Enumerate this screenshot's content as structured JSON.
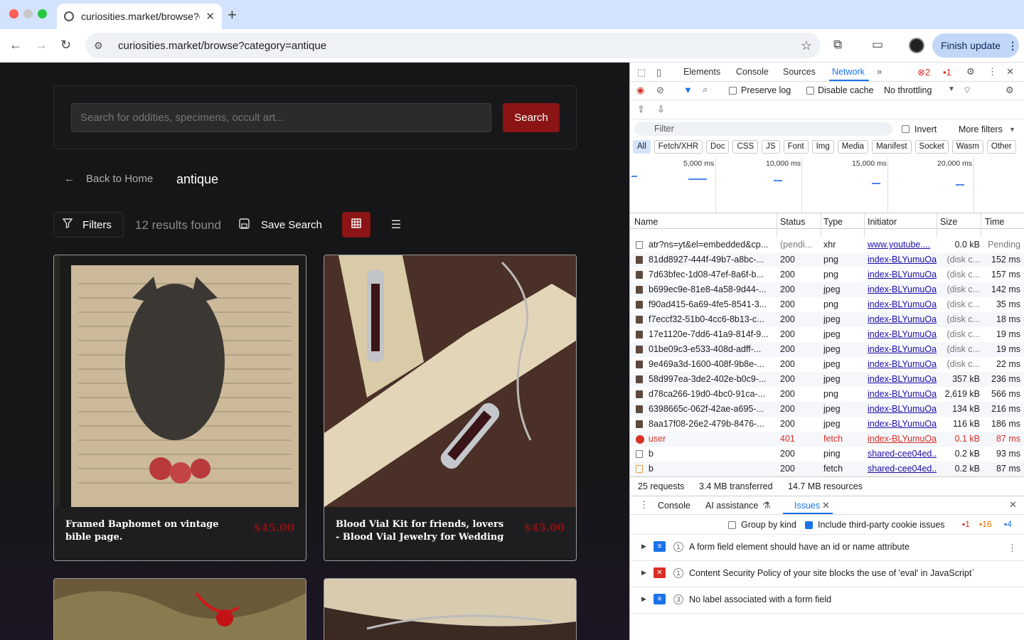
{
  "browser": {
    "tab_title": "curiosities.market/browse?ca",
    "url": "curiosities.market/browse?category=antique",
    "update_label": "Finish update"
  },
  "page": {
    "search_placeholder": "Search for oddities, specimens, occult art...",
    "search_button": "Search",
    "back_label": "Back to Home",
    "category_title": "antique",
    "filters_label": "Filters",
    "results_text": "12 results found",
    "save_search_label": "Save Search",
    "products": [
      {
        "name": "Framed Baphomet on vintage bible page.",
        "price": "$45.00"
      },
      {
        "name": "Blood Vial Kit for friends, lovers - Blood Vial Jewelry for Wedding",
        "price": "$45.00"
      }
    ]
  },
  "devtools": {
    "tabs": [
      "Elements",
      "Console",
      "Sources",
      "Network"
    ],
    "selected_tab": "Network",
    "error_count": "2",
    "warning_count": "1",
    "preserve_log": "Preserve log",
    "disable_cache": "Disable cache",
    "throttling": "No throttling",
    "filter_placeholder": "Filter",
    "invert": "Invert",
    "more_filters": "More filters",
    "type_filters": [
      "All",
      "Fetch/XHR",
      "Doc",
      "CSS",
      "JS",
      "Font",
      "Img",
      "Media",
      "Manifest",
      "Socket",
      "Wasm",
      "Other"
    ],
    "timeline_ticks": [
      "5,000 ms",
      "10,000 ms",
      "15,000 ms",
      "20,000 ms"
    ],
    "columns": [
      "Name",
      "Status",
      "Type",
      "Initiator",
      "Size",
      "Time"
    ],
    "rows": [
      {
        "name": "atr?ns=yt&el=embedded&cp...",
        "status": "(pendi...",
        "type": "xhr",
        "initiator": "www.youtube....",
        "size": "0.0 kB",
        "time": "Pending",
        "kind": "doc"
      },
      {
        "name": "81dd8927-444f-49b7-a8bc-...",
        "status": "200",
        "type": "png",
        "initiator": "index-BLYumuOa",
        "size": "(disk c...",
        "time": "152 ms",
        "kind": "img"
      },
      {
        "name": "7d63bfec-1d08-47ef-8a6f-b...",
        "status": "200",
        "type": "png",
        "initiator": "index-BLYumuOa",
        "size": "(disk c...",
        "time": "157 ms",
        "kind": "img"
      },
      {
        "name": "b699ec9e-81e8-4a58-9d44-...",
        "status": "200",
        "type": "jpeg",
        "initiator": "index-BLYumuOa",
        "size": "(disk c...",
        "time": "142 ms",
        "kind": "img"
      },
      {
        "name": "f90ad415-6a69-4fe5-8541-3...",
        "status": "200",
        "type": "png",
        "initiator": "index-BLYumuOa",
        "size": "(disk c...",
        "time": "35 ms",
        "kind": "img"
      },
      {
        "name": "f7eccf32-51b0-4cc6-8b13-c...",
        "status": "200",
        "type": "jpeg",
        "initiator": "index-BLYumuOa",
        "size": "(disk c...",
        "time": "18 ms",
        "kind": "img"
      },
      {
        "name": "17e1120e-7dd6-41a9-814f-9...",
        "status": "200",
        "type": "jpeg",
        "initiator": "index-BLYumuOa",
        "size": "(disk c...",
        "time": "19 ms",
        "kind": "img"
      },
      {
        "name": "01be09c3-e533-408d-adff-...",
        "status": "200",
        "type": "jpeg",
        "initiator": "index-BLYumuOa",
        "size": "(disk c...",
        "time": "19 ms",
        "kind": "img"
      },
      {
        "name": "9e469a3d-1600-408f-9b8e-...",
        "status": "200",
        "type": "jpeg",
        "initiator": "index-BLYumuOa",
        "size": "(disk c...",
        "time": "22 ms",
        "kind": "img"
      },
      {
        "name": "58d997ea-3de2-402e-b0c9-...",
        "status": "200",
        "type": "jpeg",
        "initiator": "index-BLYumuOa",
        "size": "357 kB",
        "time": "236 ms",
        "kind": "img"
      },
      {
        "name": "d78ca266-19d0-4bc0-91ca-...",
        "status": "200",
        "type": "png",
        "initiator": "index-BLYumuOa",
        "size": "2,619 kB",
        "time": "566 ms",
        "kind": "img"
      },
      {
        "name": "6398665c-062f-42ae-a695-...",
        "status": "200",
        "type": "jpeg",
        "initiator": "index-BLYumuOa",
        "size": "134 kB",
        "time": "216 ms",
        "kind": "img"
      },
      {
        "name": "8aa17f08-26e2-479b-8476-...",
        "status": "200",
        "type": "jpeg",
        "initiator": "index-BLYumuOa",
        "size": "116 kB",
        "time": "186 ms",
        "kind": "img"
      },
      {
        "name": "user",
        "status": "401",
        "type": "fetch",
        "initiator": "index-BLYumuOa",
        "size": "0.1 kB",
        "time": "87 ms",
        "kind": "err"
      },
      {
        "name": "b",
        "status": "200",
        "type": "ping",
        "initiator": "shared-cee04ed...",
        "size": "0.2 kB",
        "time": "93 ms",
        "kind": "doc"
      },
      {
        "name": "b",
        "status": "200",
        "type": "fetch",
        "initiator": "shared-cee04ed...",
        "size": "0.2 kB",
        "time": "87 ms",
        "kind": "fetch"
      }
    ],
    "summary": {
      "requests": "25 requests",
      "transferred": "3.4 MB transferred",
      "resources": "14.7 MB resources"
    },
    "drawer_tabs": {
      "console": "Console",
      "ai": "AI assistance",
      "issues": "Issues"
    },
    "group_by_kind": "Group by kind",
    "include_third_party": "Include third-party cookie issues",
    "issue_counts": {
      "errors": "1",
      "warnings": "16",
      "info": "4"
    },
    "issues": [
      {
        "count": "1",
        "text": "A form field element should have an id or name attribute",
        "kind": "info"
      },
      {
        "count": "1",
        "text": "Content Security Policy of your site blocks the use of 'eval' in JavaScript`",
        "kind": "error"
      },
      {
        "count": "3",
        "text": "No label associated with a form field",
        "kind": "info"
      }
    ]
  },
  "colors": {
    "accent_red": "#8b1414",
    "devtools_blue": "#1a73e8",
    "error_red": "#d93025"
  }
}
